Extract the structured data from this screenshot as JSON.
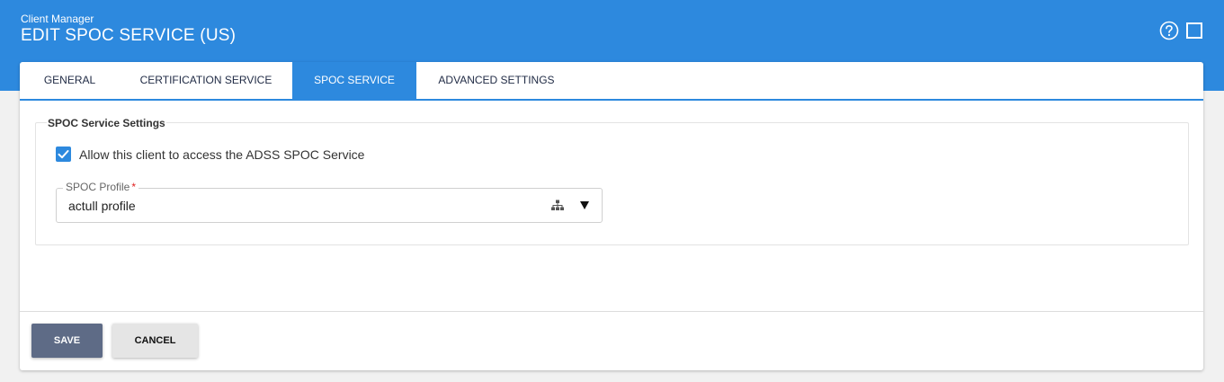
{
  "header": {
    "app_name": "Client Manager",
    "title": "EDIT SPOC SERVICE (US)",
    "help_icon": "help-circle-icon",
    "maximize_icon": "maximize-square-icon"
  },
  "tabs": [
    {
      "label": "GENERAL",
      "active": false
    },
    {
      "label": "CERTIFICATION SERVICE",
      "active": false
    },
    {
      "label": "SPOC SERVICE",
      "active": true
    },
    {
      "label": "ADVANCED SETTINGS",
      "active": false
    }
  ],
  "spoc_settings": {
    "legend": "SPOC Service Settings",
    "allow_access": {
      "label": "Allow this client to access the ADSS SPOC Service",
      "checked": true
    },
    "profile": {
      "label": "SPOC Profile",
      "required_marker": "*",
      "value": "actull profile",
      "tree_icon": "hierarchy-tree-icon",
      "dropdown_icon": "triangle-down-icon"
    }
  },
  "footer": {
    "save_label": "SAVE",
    "cancel_label": "CANCEL"
  },
  "colors": {
    "primary": "#2d89de",
    "save_button": "#5e6b86",
    "cancel_button": "#e5e5e5",
    "required": "#e02020"
  }
}
